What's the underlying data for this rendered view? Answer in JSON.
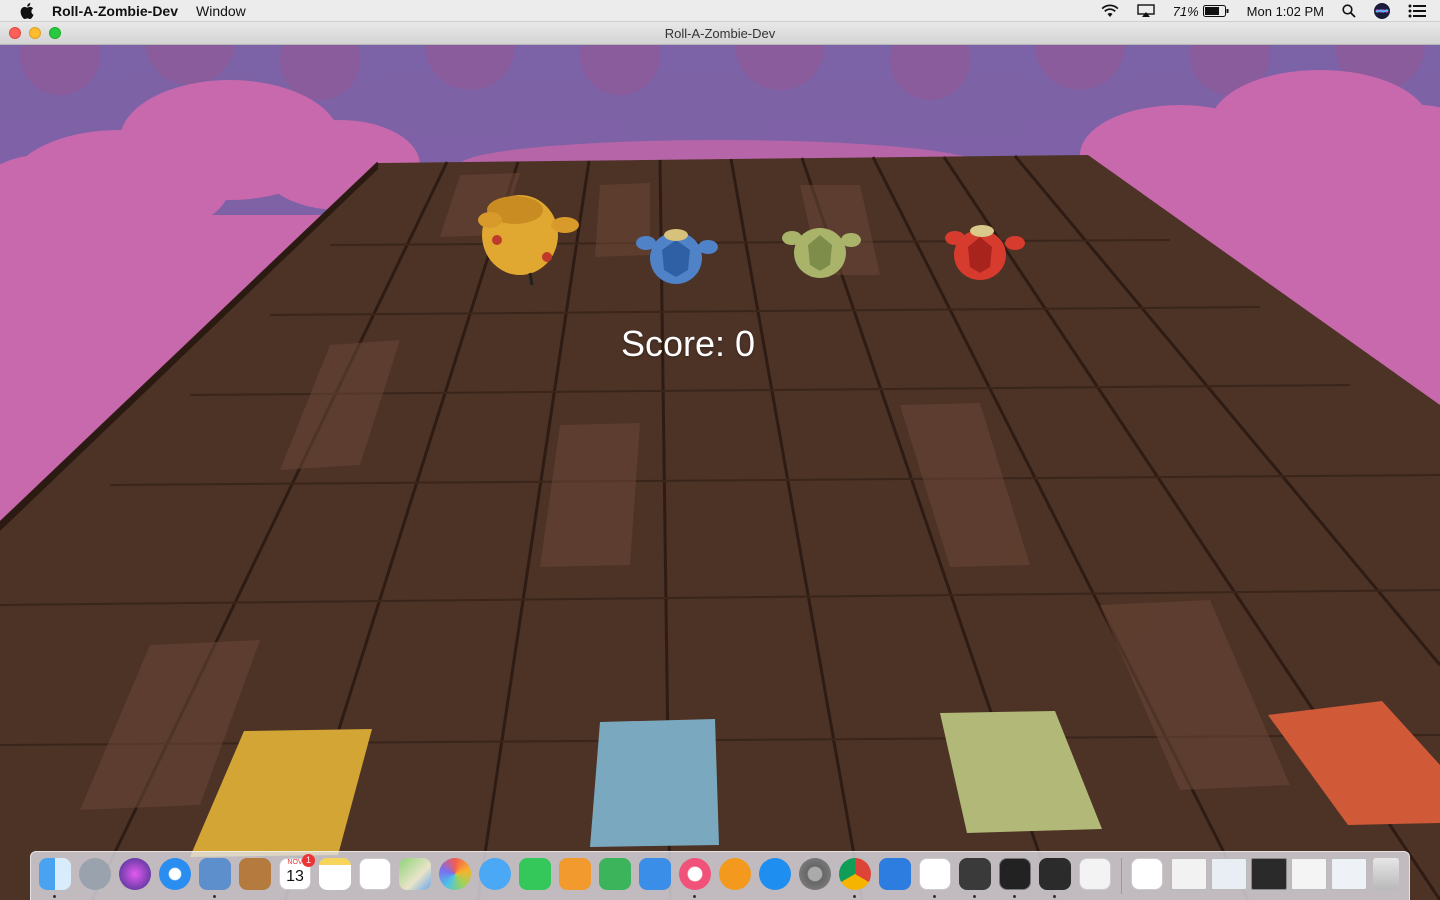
{
  "menubar": {
    "apple_icon": "apple-logo-icon",
    "app_name": "Roll-A-Zombie-Dev",
    "menus": [
      "Window"
    ],
    "battery": "71%",
    "clock": "Mon 1:02 PM",
    "status_icons": [
      "wifi-icon",
      "airplay-icon",
      "battery-icon",
      "spotlight-search-icon",
      "siri-icon",
      "notification-center-icon"
    ]
  },
  "window": {
    "title": "Roll-A-Zombie-Dev"
  },
  "game": {
    "score_text": "Score: 0",
    "colors": {
      "sky": "#8a63a8",
      "clouds": "#c36aa9",
      "floor": "#5b3d2e",
      "yellow": "#d9a53a",
      "blue": "#7ba7bf",
      "green": "#b0b978",
      "red": "#d65c3a"
    },
    "zombies": [
      "yellow-zombie",
      "blue-zombie",
      "green-zombie",
      "red-zombie"
    ],
    "goal_pads": [
      "yellow-goal-pad",
      "blue-goal-pad",
      "green-goal-pad",
      "red-goal-pad"
    ]
  },
  "dock": {
    "calendar_month": "NOV",
    "calendar_day": "13",
    "calendar_badge": "1",
    "apps": [
      "finder",
      "launchpad",
      "siri",
      "safari",
      "mail",
      "contacts",
      "calendar",
      "notes",
      "reminders",
      "maps",
      "photos",
      "messages",
      "facetime",
      "pages",
      "numbers",
      "keynote",
      "itunes",
      "ibooks",
      "app-store",
      "system-preferences",
      "chrome",
      "xcode",
      "sublime-merge",
      "sublime-text",
      "terminal",
      "visual-studio",
      "script-editor",
      "activity-monitor",
      "window-thumbnail-1",
      "window-thumbnail-2",
      "window-thumbnail-3",
      "window-thumbnail-4",
      "window-thumbnail-5",
      "trash"
    ]
  }
}
